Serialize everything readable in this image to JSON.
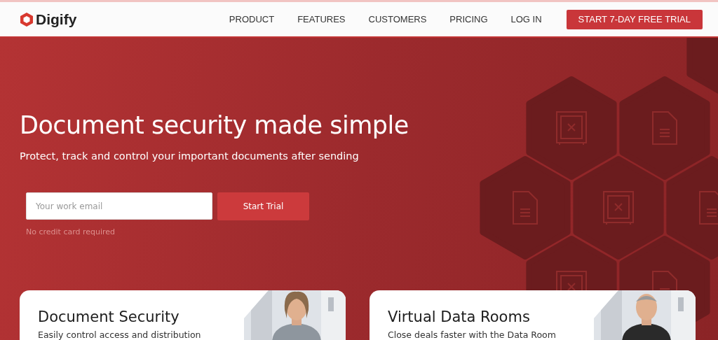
{
  "header": {
    "logo": "Digify",
    "nav": [
      {
        "label": "PRODUCT"
      },
      {
        "label": "FEATURES"
      },
      {
        "label": "CUSTOMERS"
      },
      {
        "label": "PRICING"
      },
      {
        "label": "LOG IN"
      }
    ],
    "cta": "START 7-DAY FREE TRIAL"
  },
  "hero": {
    "title": "Document security made simple",
    "subtitle": "Protect, track and control your important documents after sending",
    "email": {
      "placeholder": "Your work email"
    },
    "button": "Start Trial",
    "note": "No credit card required"
  },
  "cards": [
    {
      "title": "Document Security",
      "text": "Easily control access and distribution"
    },
    {
      "title": "Virtual Data Rooms",
      "text": "Close deals faster with the Data Room"
    }
  ]
}
